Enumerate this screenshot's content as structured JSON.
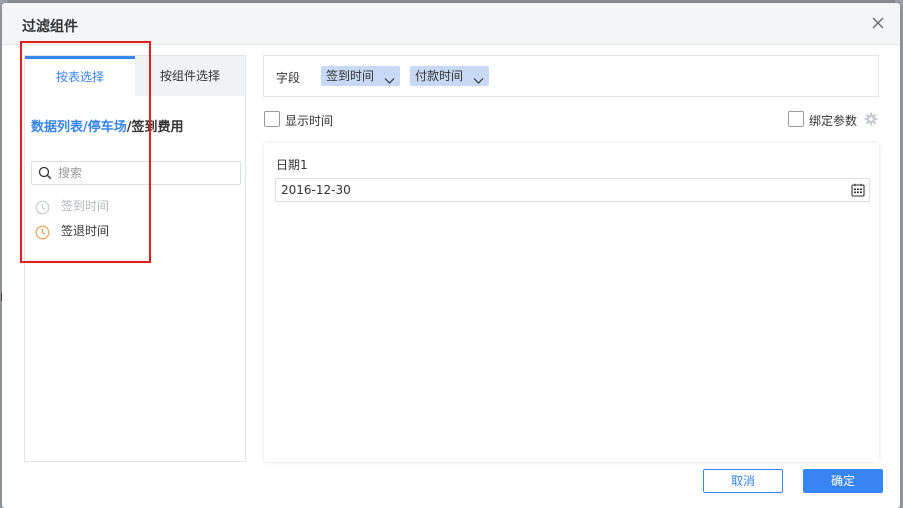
{
  "dialog": {
    "title": "过滤组件",
    "close_icon": "close-icon"
  },
  "backdrop": {
    "glyph": "B"
  },
  "left_panel": {
    "tabs": [
      {
        "label": "按表选择",
        "active": true
      },
      {
        "label": "按组件选择",
        "active": false
      }
    ],
    "breadcrumb": {
      "part1": "数据列表",
      "sep1": "/",
      "part2": "停车场",
      "sep2": "/",
      "current": "签到费用"
    },
    "search": {
      "placeholder": "搜索",
      "value": ""
    },
    "fields": [
      {
        "label": "签到时间",
        "icon": "clock-icon",
        "state": "disabled"
      },
      {
        "label": "签退时间",
        "icon": "clock-icon",
        "state": "enabled"
      }
    ]
  },
  "field_row": {
    "label": "字段",
    "chips": [
      "签到时间",
      "付款时间"
    ]
  },
  "options": {
    "show_time_label": "显示时间",
    "show_time_checked": false,
    "bind_param_label": "绑定参数",
    "bind_param_checked": false
  },
  "preview": {
    "label": "日期1",
    "date_value": "2016-12-30"
  },
  "footer": {
    "cancel_label": "取消",
    "ok_label": "确定"
  },
  "colors": {
    "accent": "#3685f2",
    "chip_bg": "#c7d9f5",
    "highlight": "#e02020",
    "clock_orange": "#f0a050"
  }
}
